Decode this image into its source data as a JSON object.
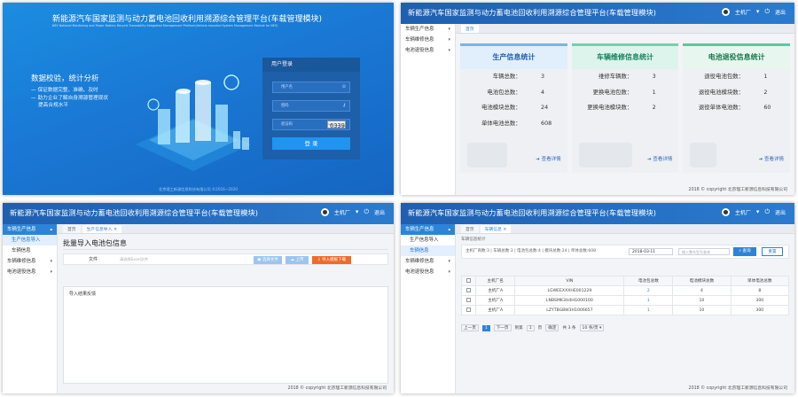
{
  "app_title": "新能源汽车国家监测与动力蓄电池回收利用溯源综合管理平台(车载管理模块)",
  "app_subtitle": "NEV National Monitoring and Power Battery Recycle Traceability Integrated Management Platform(Vehicle-mounted System Management Module for NEV)",
  "user": {
    "name": "主机厂",
    "logout": "退出"
  },
  "login": {
    "slogan_heading": "数据校验，统计分析",
    "slogan_lines": [
      "— 保证数据完整、准确、及时",
      "— 助力企业了解自身溯源管理现状",
      "提高合规水平"
    ],
    "box_title": "用户登录",
    "username_placeholder": "用户名",
    "password_placeholder": "密码",
    "captcha_placeholder": "验证码",
    "captcha_text": "6339",
    "login_button": "登 录",
    "copyright": "北京理工新源信息科技有限公司 ©2016~2020"
  },
  "sidebar": {
    "dashboard_items": [
      "车辆生产信息",
      "车辆维修信息",
      "电池退役信息"
    ],
    "import_items": [
      "车辆生产信息",
      "生产信息导入",
      "车辆信息",
      "车辆维修信息",
      "电池退役信息"
    ],
    "table_items": [
      "车辆生产信息",
      "生产信息导入",
      "车辆信息",
      "车辆维修信息",
      "电池退役信息"
    ]
  },
  "tabs": {
    "home": "首页",
    "import": "生产信息导入",
    "table": "车辆信息"
  },
  "cards": [
    {
      "title": "生产信息统计",
      "rows": [
        [
          "车辆总数：",
          "3"
        ],
        [
          "电池包总数：",
          "4"
        ],
        [
          "电池模块总数：",
          "24"
        ],
        [
          "单体电池总数：",
          "608"
        ]
      ],
      "more": "查看详情"
    },
    {
      "title": "车辆维修信息统计",
      "rows": [
        [
          "维修车辆数：",
          "3"
        ],
        [
          "更换电池包数：",
          "1"
        ],
        [
          "更换电池模块数：",
          "2"
        ]
      ],
      "more": "查看详情"
    },
    {
      "title": "电池退役信息统计",
      "rows": [
        [
          "退役电池包数：",
          "1"
        ],
        [
          "退役电池模块数：",
          "2"
        ],
        [
          "退役单体电池数：",
          "60"
        ]
      ],
      "more": "查看详情"
    }
  ],
  "footer": "2018 © copyright 北京理工新源信息科技有限公司",
  "import_page": {
    "heading": "批量导入电池包信息",
    "file_label": "文件",
    "file_placeholder": "请选择Excel文件",
    "choose_button": "选择文件",
    "upload_button": "上传",
    "template_button": "导入模板下载",
    "result_label": "导入结果反馈"
  },
  "table_page": {
    "breadcrumb": "车辆信息统计",
    "summary": "主机厂商数:3 | 车辆总数:3 | 电池包总数:4 | 模块总数:24 | 单体总数:608",
    "date_value": "2018-03-11",
    "search_placeholder": "输入整车型号查询",
    "search_button": "查询",
    "reset_button": "重置",
    "columns": [
      "主机厂名",
      "VIN",
      "电池包总数",
      "电池模块总数",
      "单体电池总数"
    ],
    "rows": [
      [
        "主机厂A",
        "LGWEEXXXHE001229",
        "2",
        "4",
        "8"
      ],
      [
        "主机厂A",
        "LNBSMK3H4HG000100",
        "1",
        "10",
        "300"
      ],
      [
        "主机厂A",
        "LZYTBGBW3H1006657",
        "1",
        "10",
        "300"
      ]
    ],
    "pager": {
      "prev": "上一页",
      "current": "1",
      "next": "下一页",
      "goto": "到第",
      "page": "页",
      "confirm": "确定",
      "total": "共 3 条",
      "per_page": "10 条/页"
    }
  },
  "colors": {
    "brand_blue": "#1f5fb0",
    "accent": "#2d84d6",
    "template_orange": "#f06a2a"
  }
}
